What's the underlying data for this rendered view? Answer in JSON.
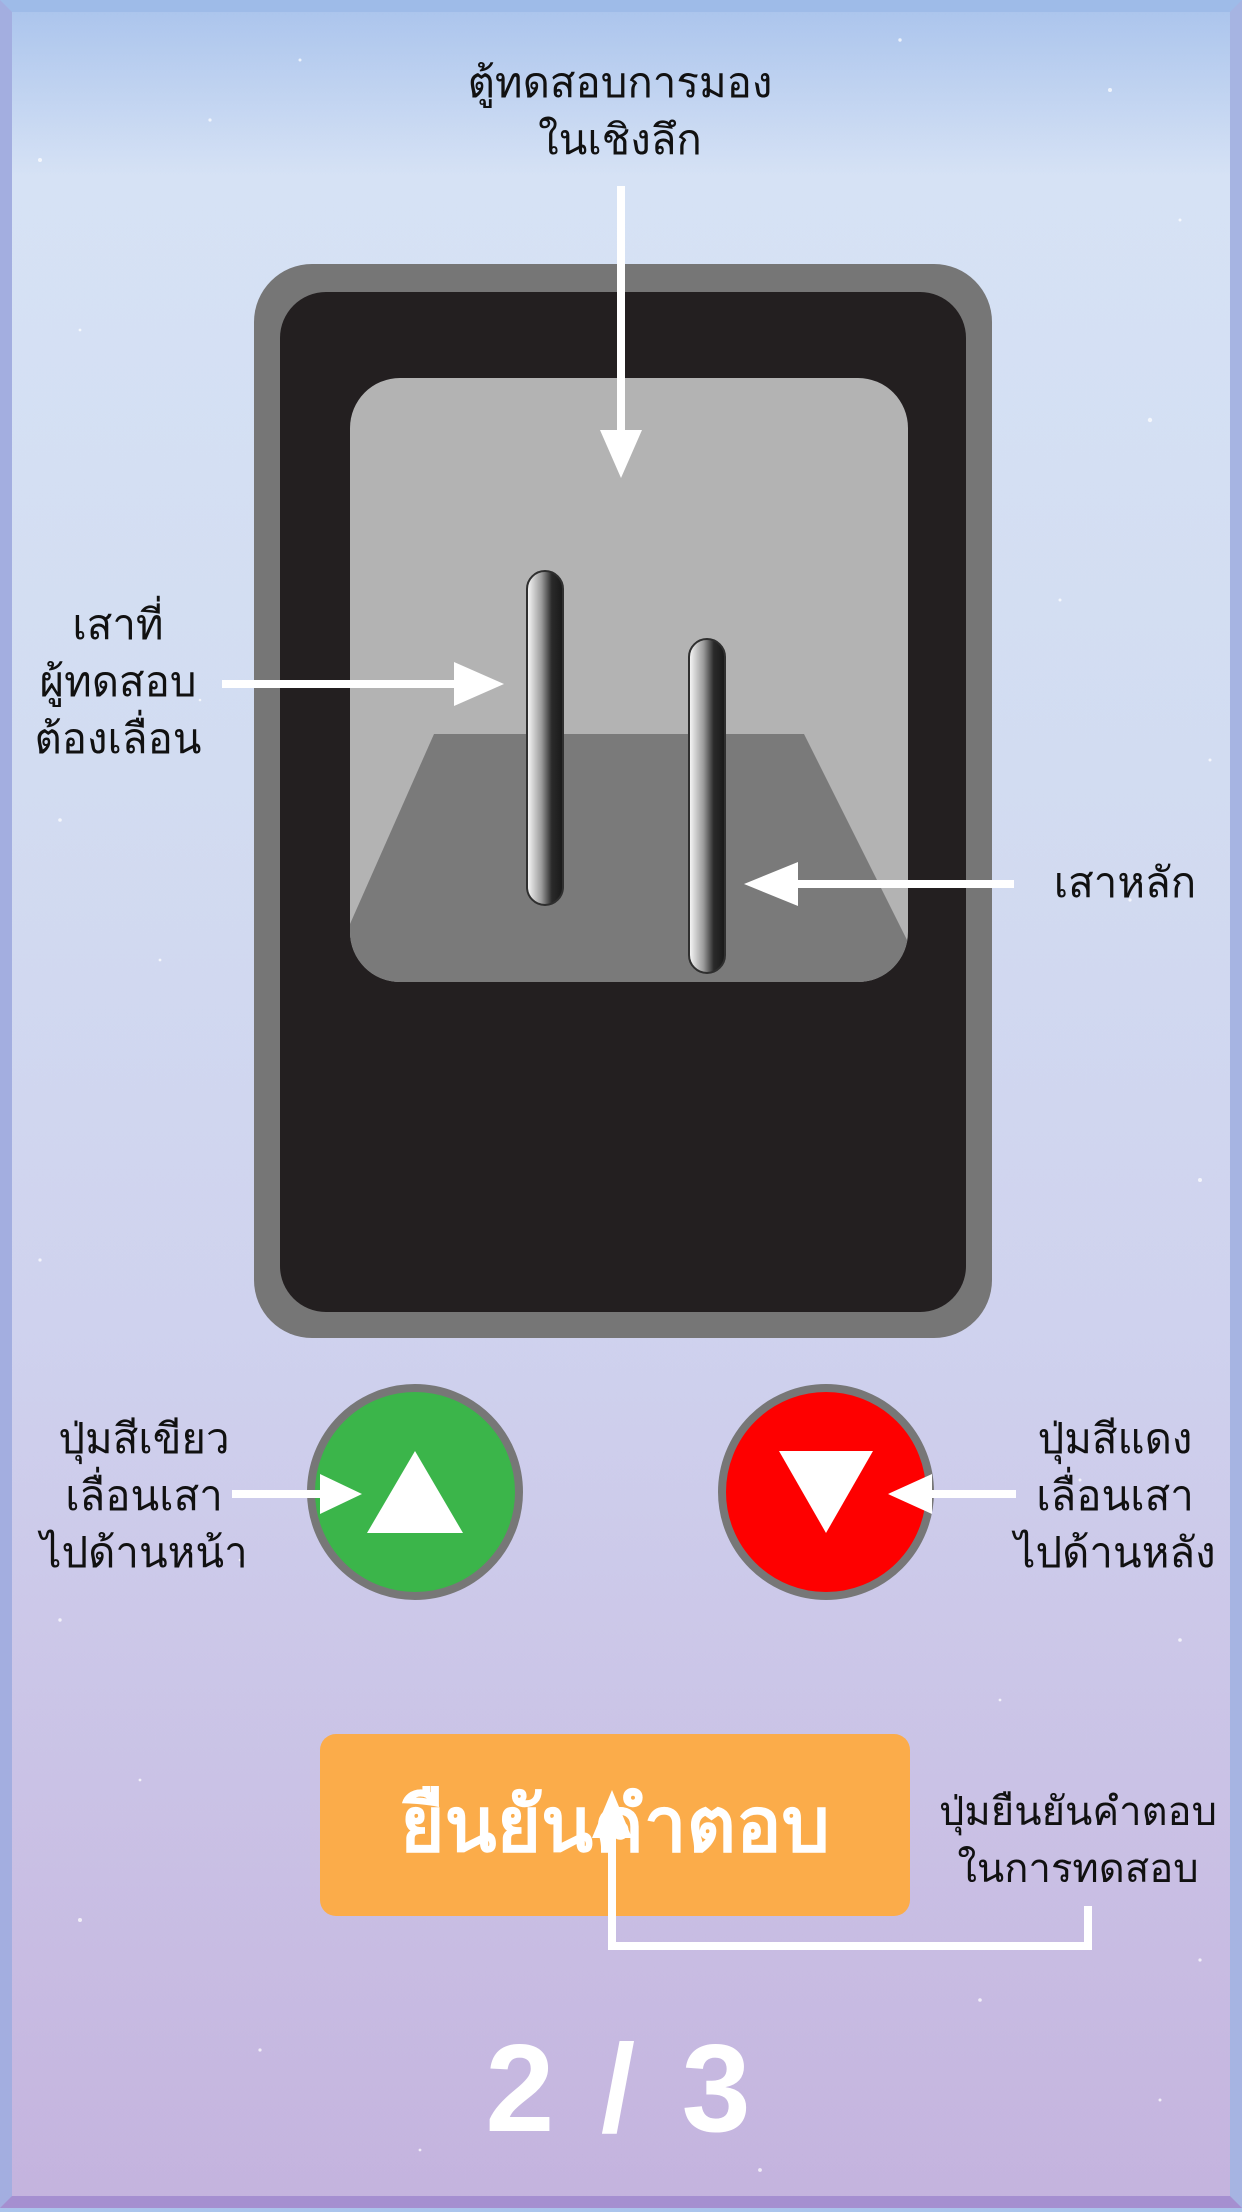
{
  "labels": {
    "viewer_box": "ตู้ทดสอบการมอง\nในเชิงลึก",
    "movable_rod": "เสาที่\nผู้ทดสอบ\nต้องเลื่อน",
    "main_rod": "เสาหลัก",
    "green_button": "ปุ่มสีเขียว\nเลื่อนเสา\nไปด้านหน้า",
    "red_button": "ปุ่มสีแดง\nเลื่อนเสา\nไปด้านหลัง",
    "confirm_button_desc": "ปุ่มยืนยันคำตอบ\nในการทดสอบ"
  },
  "buttons": {
    "confirm_label": "ยืนยันคำตอบ",
    "forward_icon": "triangle-up-icon",
    "backward_icon": "triangle-down-icon"
  },
  "progress": {
    "current": 2,
    "total": 3,
    "text": "2 / 3"
  },
  "colors": {
    "green_button": "#3bb54a",
    "red_button": "#fe0000",
    "confirm_button": "#fbac4a",
    "device_frame": "#767676",
    "device_body": "#231f20",
    "viewport": "#b3b3b3",
    "floor": "#7a7a7a"
  }
}
